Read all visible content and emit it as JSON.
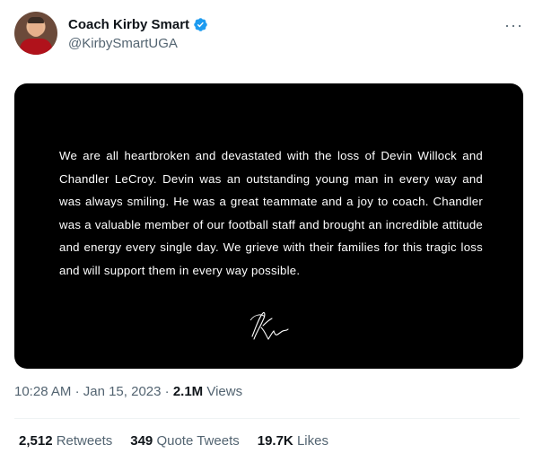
{
  "author": {
    "display_name": "Coach Kirby Smart",
    "handle": "@KirbySmartUGA",
    "verified": true
  },
  "icons": {
    "verified": "verified-badge-icon",
    "more": "more-options-icon",
    "verified_color": "#1d9bf0"
  },
  "statement": {
    "text": "We are all heartbroken and devastated with the loss of Devin Willock and Chandler LeCroy. Devin was an outstanding young man in every way and was always smiling. He was a great teammate and a joy to coach. Chandler was a valuable member of our football staff and brought an incredible attitude and energy every single day. We grieve with their families for this tragic loss and will support them in every way possible."
  },
  "meta": {
    "time": "10:28 AM",
    "separator": "·",
    "date": "Jan 15, 2023",
    "views_count": "2.1M",
    "views_label": "Views"
  },
  "stats": {
    "retweets_count": "2,512",
    "retweets_label": "Retweets",
    "quotes_count": "349",
    "quotes_label": "Quote Tweets",
    "likes_count": "19.7K",
    "likes_label": "Likes"
  }
}
